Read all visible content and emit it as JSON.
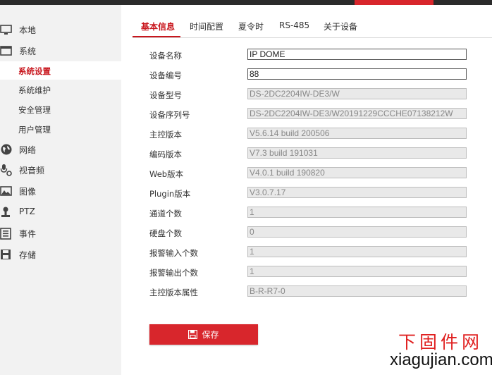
{
  "sidebar": {
    "items": [
      {
        "label": "本地",
        "icon": "monitor-icon"
      },
      {
        "label": "系统",
        "icon": "system-window-icon"
      },
      {
        "label": "网络",
        "icon": "globe-icon"
      },
      {
        "label": "视音频",
        "icon": "audio-video-icon"
      },
      {
        "label": "图像",
        "icon": "image-icon"
      },
      {
        "label": "PTZ",
        "icon": "ptz-icon"
      },
      {
        "label": "事件",
        "icon": "event-list-icon"
      },
      {
        "label": "存储",
        "icon": "storage-floppy-icon"
      }
    ],
    "system_sub": [
      {
        "label": "系统设置",
        "active": true
      },
      {
        "label": "系统维护"
      },
      {
        "label": "安全管理"
      },
      {
        "label": "用户管理"
      }
    ]
  },
  "tabs": [
    {
      "label": "基本信息",
      "active": true
    },
    {
      "label": "时间配置"
    },
    {
      "label": "夏令时"
    },
    {
      "label": "RS-485"
    },
    {
      "label": "关于设备"
    }
  ],
  "form": {
    "rows": [
      {
        "label": "设备名称",
        "value": "IP DOME",
        "editable": true
      },
      {
        "label": "设备编号",
        "value": "88",
        "editable": true
      },
      {
        "label": "设备型号",
        "value": "DS-2DC2204IW-DE3/W"
      },
      {
        "label": "设备序列号",
        "value": "DS-2DC2204IW-DE3/W20191229CCCHE07138212W"
      },
      {
        "label": "主控版本",
        "value": "V5.6.14 build 200506"
      },
      {
        "label": "编码版本",
        "value": "V7.3 build 191031"
      },
      {
        "label": "Web版本",
        "value": "V4.0.1 build 190820"
      },
      {
        "label": "Plugin版本",
        "value": "V3.0.7.17"
      },
      {
        "label": "通道个数",
        "value": "1"
      },
      {
        "label": "硬盘个数",
        "value": "0"
      },
      {
        "label": "报警输入个数",
        "value": "1"
      },
      {
        "label": "报警输出个数",
        "value": "1"
      },
      {
        "label": "主控版本属性",
        "value": "B-R-R7-0"
      }
    ]
  },
  "actions": {
    "save_label": "保存",
    "save_icon": "save-floppy-icon"
  },
  "watermark": {
    "cn": "下固件网",
    "url": "xiagujian.com"
  },
  "colors": {
    "accent": "#d8262c",
    "topbar": "#2b2b2b",
    "sidebar_bg": "#f2f2f2",
    "readonly_field": "#e9e9e9",
    "watermark_cn": "#e02020"
  }
}
